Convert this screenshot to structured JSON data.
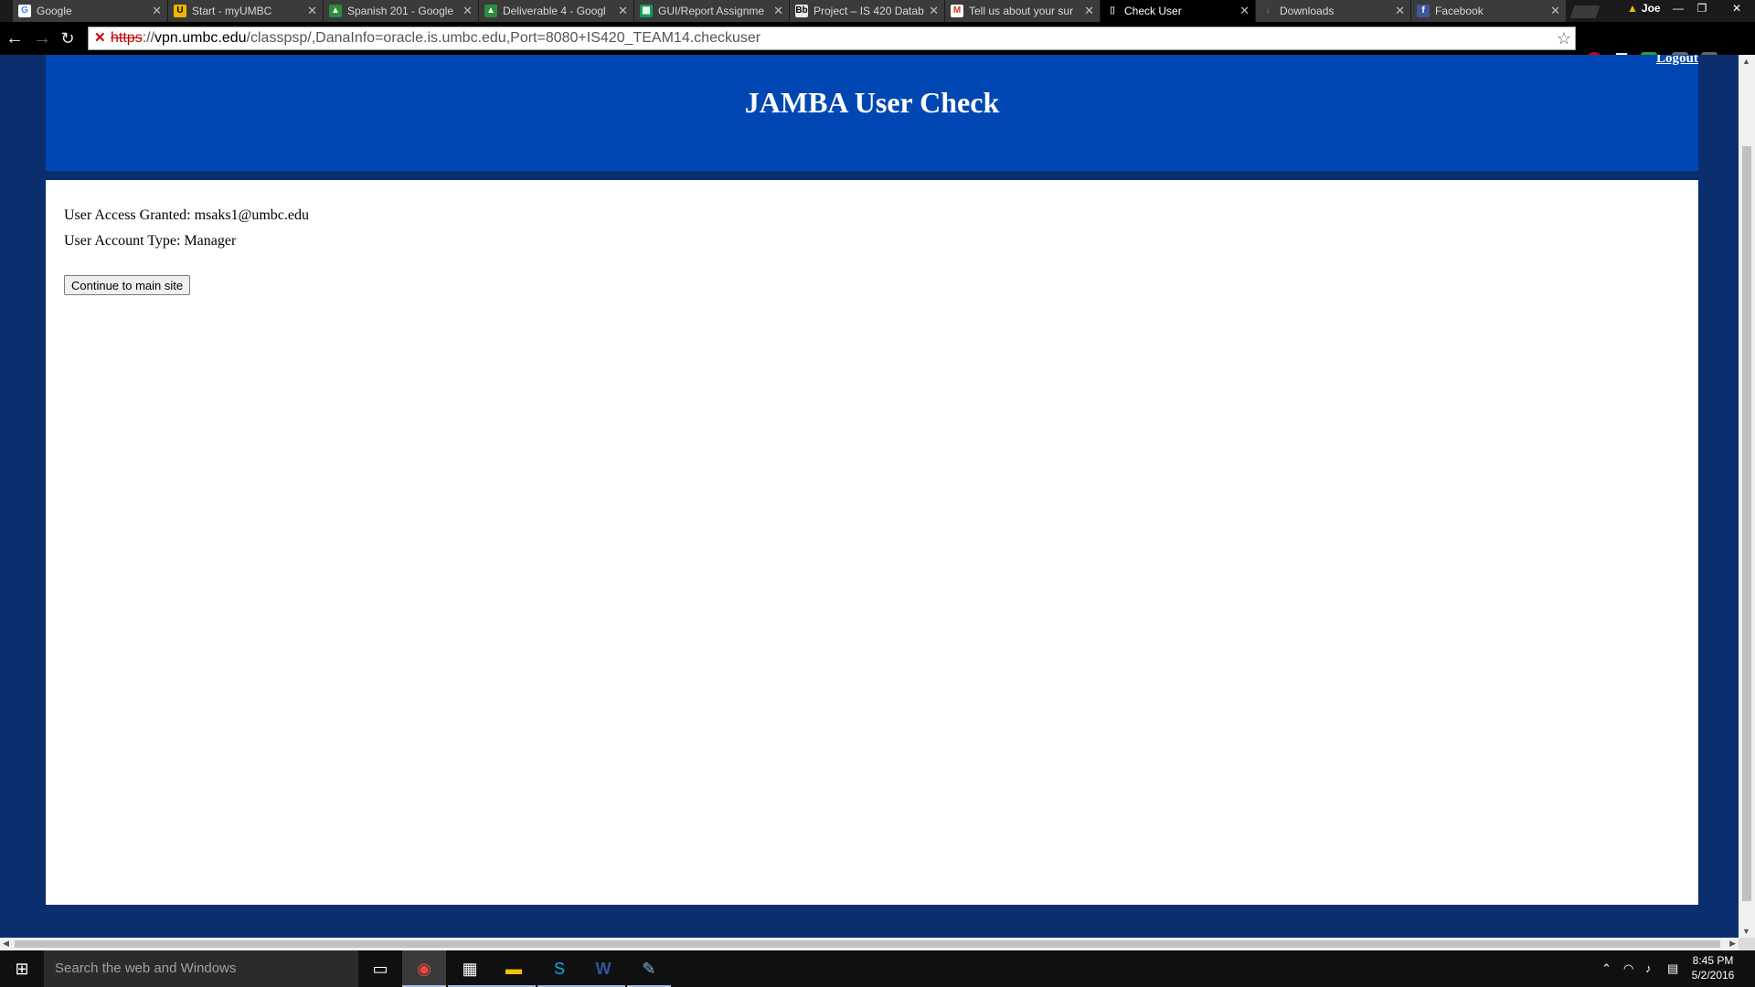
{
  "browser": {
    "tabs": [
      {
        "label": "Google",
        "icon": "google-icon",
        "active": false
      },
      {
        "label": "Start - myUMBC",
        "icon": "umbc-icon",
        "active": false
      },
      {
        "label": "Spanish 201 - Google",
        "icon": "drive-icon",
        "active": false
      },
      {
        "label": "Deliverable 4 - Googl",
        "icon": "drive-icon",
        "active": false
      },
      {
        "label": "GUI/Report Assignme",
        "icon": "sheets-icon",
        "active": false
      },
      {
        "label": "Project – IS 420 Datab",
        "icon": "blackboard-icon",
        "active": false
      },
      {
        "label": "Tell us about your sur",
        "icon": "gmail-icon",
        "active": false
      },
      {
        "label": "Check User",
        "icon": "page-icon",
        "active": true
      },
      {
        "label": "Downloads",
        "icon": "download-icon",
        "active": false
      },
      {
        "label": "Facebook",
        "icon": "facebook-icon",
        "active": false
      }
    ],
    "profile_name": "Joe",
    "url": {
      "scheme": "https",
      "host": "vpn.umbc.edu",
      "path": "/classpsp/,DanaInfo=oracle.is.umbc.edu,Port=8080+IS420_TEAM14.checkuser"
    }
  },
  "page": {
    "logout_label": "Logout",
    "title": "JAMBA User Check",
    "access_line": "User Access Granted: msaks1@umbc.edu",
    "account_type_line": "User Account Type: Manager",
    "continue_label": "Continue to main site"
  },
  "taskbar": {
    "search_placeholder": "Search the web and Windows",
    "time": "8:45 PM",
    "date": "5/2/2016"
  }
}
